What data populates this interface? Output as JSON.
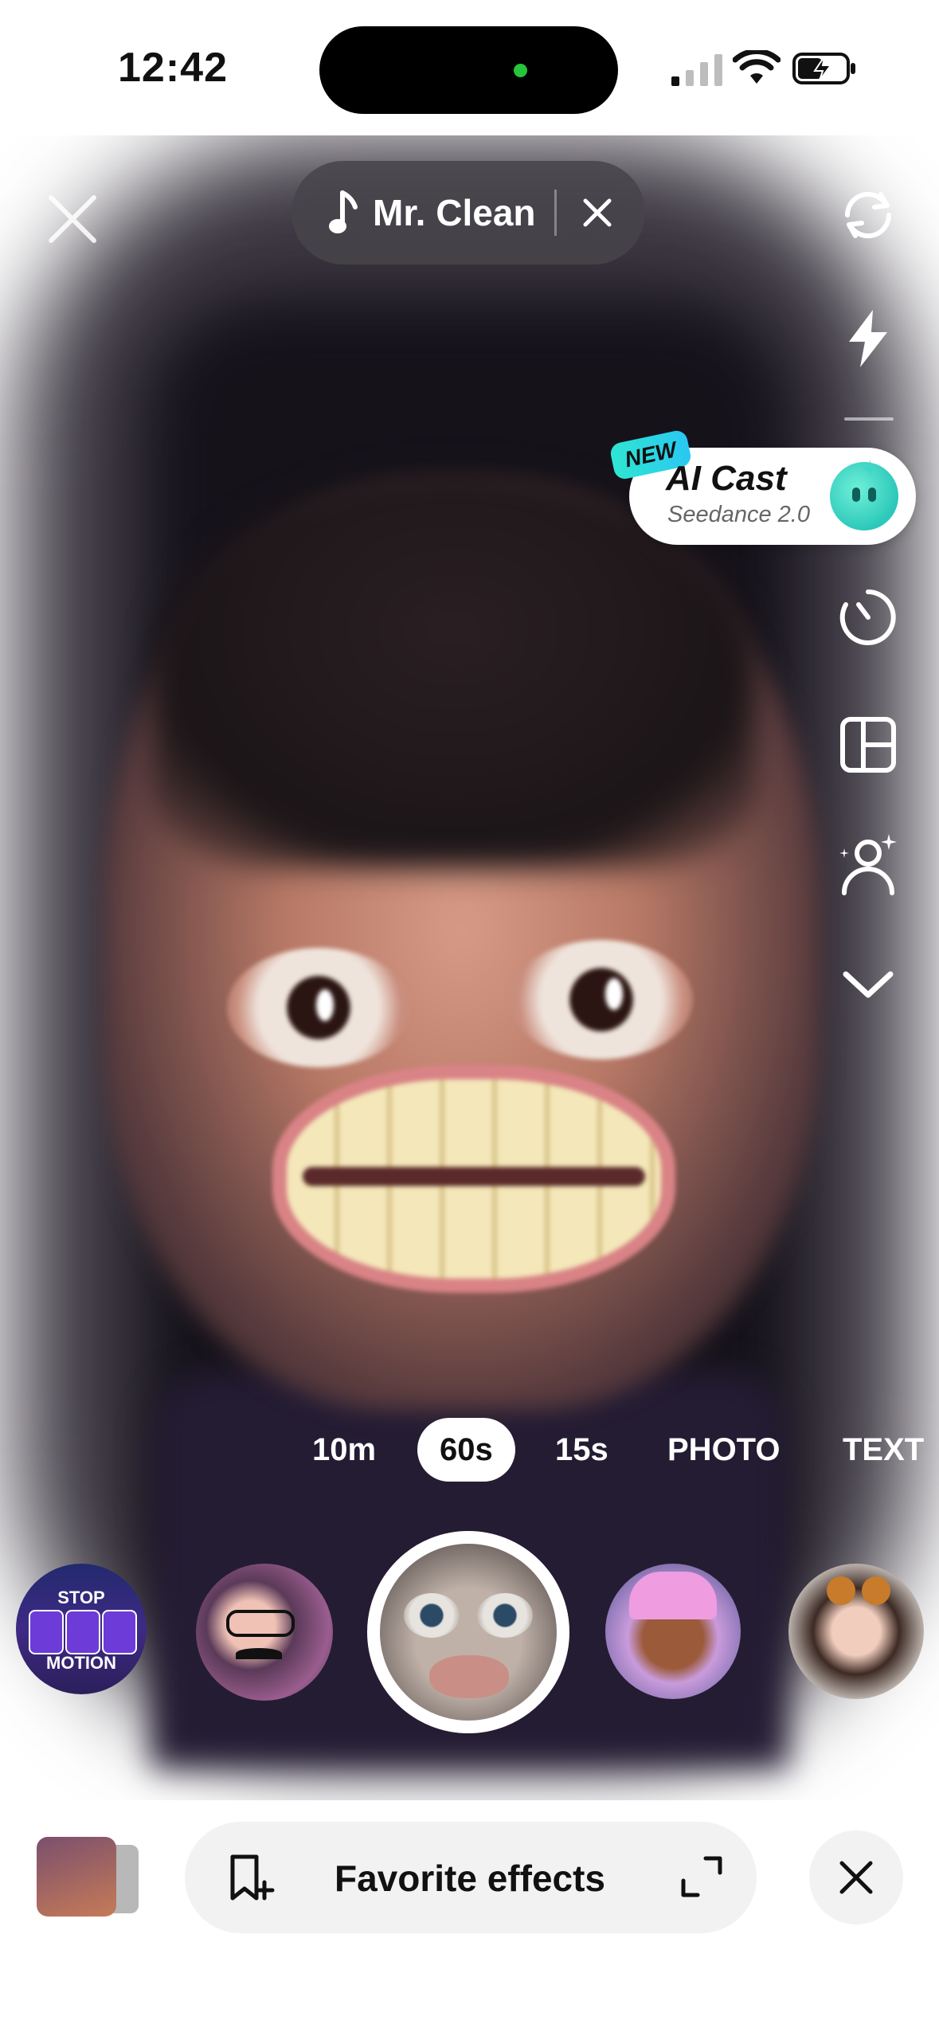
{
  "status_bar": {
    "time": "12:42"
  },
  "music": {
    "title": "Mr. Clean"
  },
  "ai_cast": {
    "badge": "NEW",
    "title": "AI Cast",
    "subtitle": "Seedance 2.0"
  },
  "modes": [
    {
      "label": "10m",
      "active": false
    },
    {
      "label": "60s",
      "active": true
    },
    {
      "label": "15s",
      "active": false
    },
    {
      "label": "PHOTO",
      "active": false
    },
    {
      "label": "TEXT",
      "active": false
    }
  ],
  "effects": {
    "stop_motion_top": "STOP",
    "stop_motion_bottom": "MOTION"
  },
  "bottom": {
    "favorites_label": "Favorite effects"
  },
  "colors": {
    "ai_badge": "#2ee6d2",
    "ai_icon": "#2cc8b9",
    "island_indicator": "#26c53a"
  }
}
